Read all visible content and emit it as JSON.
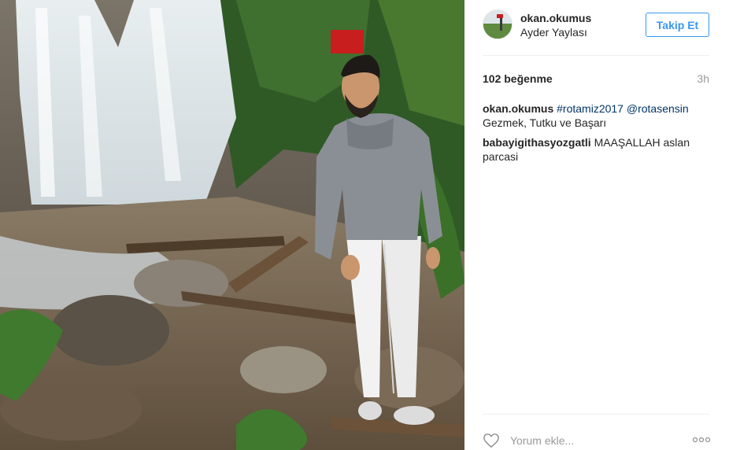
{
  "post": {
    "username": "okan.okumus",
    "location": "Ayder Yaylası",
    "follow_label": "Takip Et",
    "likes": "102 beğenme",
    "time_ago": "3h"
  },
  "comments": [
    {
      "user": "okan.okumus",
      "parts": [
        {
          "text": "#rotamiz2017",
          "type": "tag"
        },
        {
          "text": " ",
          "type": "text"
        },
        {
          "text": "@rotasensin",
          "type": "tag"
        },
        {
          "text": " Gezmek, Tutku ve Başarı",
          "type": "text"
        }
      ]
    },
    {
      "user": "babayigithasyozgatli",
      "parts": [
        {
          "text": " MAAŞALLAH aslan parcasi",
          "type": "text"
        }
      ]
    }
  ],
  "footer": {
    "comment_placeholder": "Yorum ekle...",
    "like_icon": "heart-outline-icon",
    "more_icon": "ellipsis-icon"
  },
  "colors": {
    "accent": "#3897f0",
    "hashtag": "#003569",
    "muted": "#999999"
  }
}
